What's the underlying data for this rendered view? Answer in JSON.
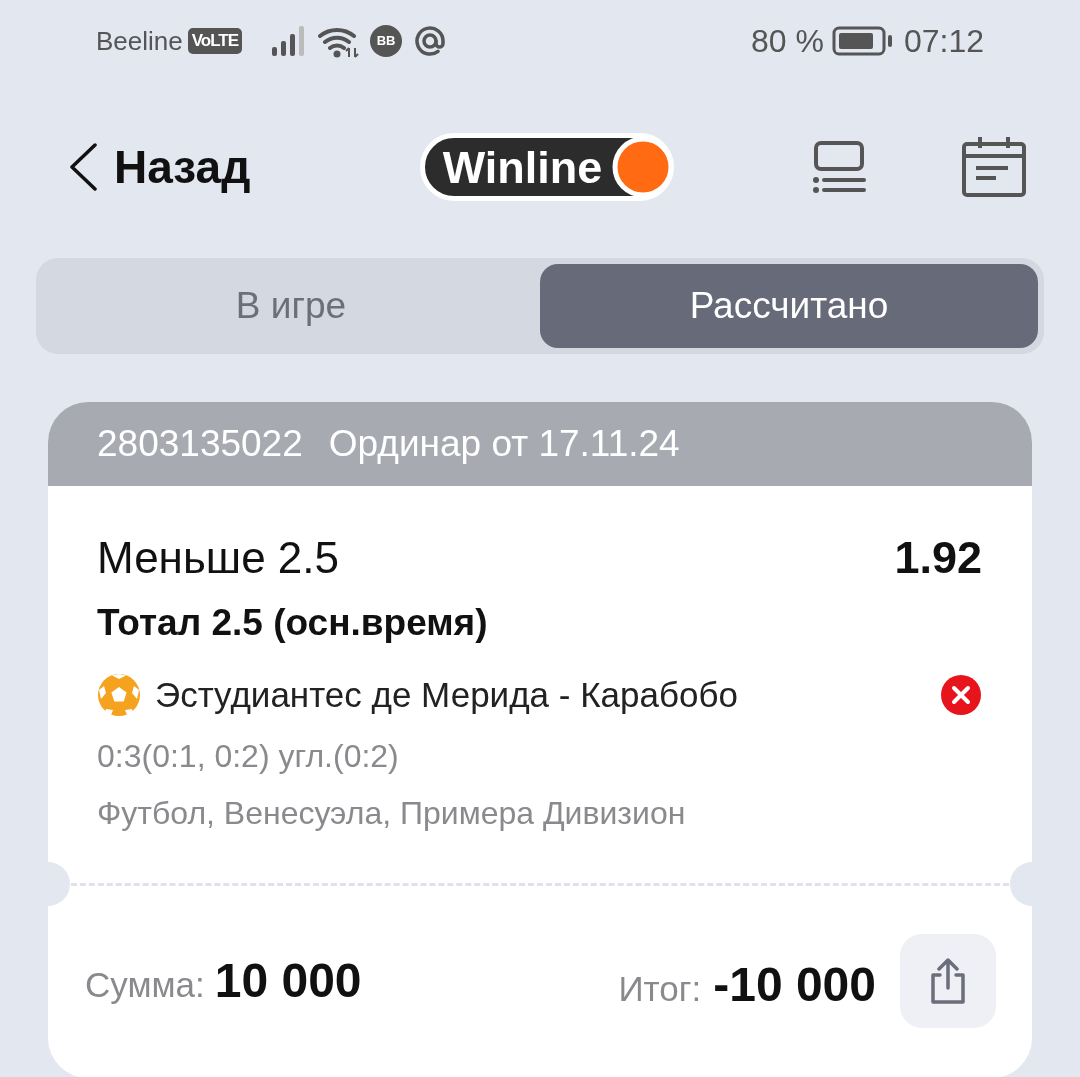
{
  "status_bar": {
    "carrier": "Beeline",
    "volte": "VoLTE",
    "notification_badge": "BB",
    "battery_percent": "80 %",
    "time": "07:12"
  },
  "header": {
    "back_label": "Назад",
    "logo_text": "Winline"
  },
  "tabs": [
    {
      "label": "В игре",
      "selected": false
    },
    {
      "label": "Рассчитано",
      "selected": true
    }
  ],
  "bet": {
    "number": "2803135022",
    "type_date": "Ординар от 17.11.24",
    "selection": "Меньше 2.5",
    "odds": "1.92",
    "market": "Тотал 2.5 (осн.время)",
    "event": "Эстудиантес де Мерида - Карабобо",
    "won": false,
    "score": "0:3(0:1, 0:2) угл.(0:2)",
    "league": "Футбол, Венесуэла, Примера Дивизион",
    "stake_label": "Сумма:",
    "stake": "10 000",
    "total_label": "Итог:",
    "total": "-10 000"
  }
}
